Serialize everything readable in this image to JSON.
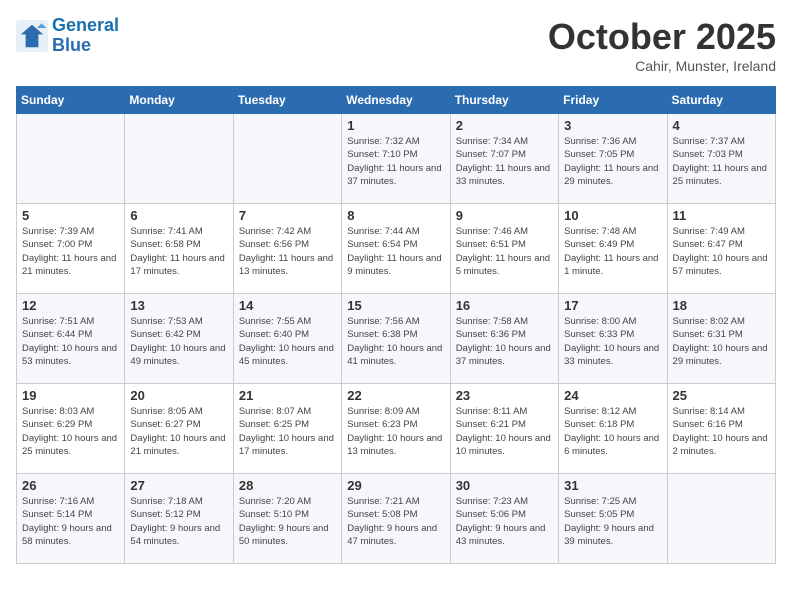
{
  "header": {
    "logo_line1": "General",
    "logo_line2": "Blue",
    "month": "October 2025",
    "location": "Cahir, Munster, Ireland"
  },
  "weekdays": [
    "Sunday",
    "Monday",
    "Tuesday",
    "Wednesday",
    "Thursday",
    "Friday",
    "Saturday"
  ],
  "weeks": [
    [
      {
        "day": "",
        "info": ""
      },
      {
        "day": "",
        "info": ""
      },
      {
        "day": "",
        "info": ""
      },
      {
        "day": "1",
        "info": "Sunrise: 7:32 AM\nSunset: 7:10 PM\nDaylight: 11 hours\nand 37 minutes."
      },
      {
        "day": "2",
        "info": "Sunrise: 7:34 AM\nSunset: 7:07 PM\nDaylight: 11 hours\nand 33 minutes."
      },
      {
        "day": "3",
        "info": "Sunrise: 7:36 AM\nSunset: 7:05 PM\nDaylight: 11 hours\nand 29 minutes."
      },
      {
        "day": "4",
        "info": "Sunrise: 7:37 AM\nSunset: 7:03 PM\nDaylight: 11 hours\nand 25 minutes."
      }
    ],
    [
      {
        "day": "5",
        "info": "Sunrise: 7:39 AM\nSunset: 7:00 PM\nDaylight: 11 hours\nand 21 minutes."
      },
      {
        "day": "6",
        "info": "Sunrise: 7:41 AM\nSunset: 6:58 PM\nDaylight: 11 hours\nand 17 minutes."
      },
      {
        "day": "7",
        "info": "Sunrise: 7:42 AM\nSunset: 6:56 PM\nDaylight: 11 hours\nand 13 minutes."
      },
      {
        "day": "8",
        "info": "Sunrise: 7:44 AM\nSunset: 6:54 PM\nDaylight: 11 hours\nand 9 minutes."
      },
      {
        "day": "9",
        "info": "Sunrise: 7:46 AM\nSunset: 6:51 PM\nDaylight: 11 hours\nand 5 minutes."
      },
      {
        "day": "10",
        "info": "Sunrise: 7:48 AM\nSunset: 6:49 PM\nDaylight: 11 hours\nand 1 minute."
      },
      {
        "day": "11",
        "info": "Sunrise: 7:49 AM\nSunset: 6:47 PM\nDaylight: 10 hours\nand 57 minutes."
      }
    ],
    [
      {
        "day": "12",
        "info": "Sunrise: 7:51 AM\nSunset: 6:44 PM\nDaylight: 10 hours\nand 53 minutes."
      },
      {
        "day": "13",
        "info": "Sunrise: 7:53 AM\nSunset: 6:42 PM\nDaylight: 10 hours\nand 49 minutes."
      },
      {
        "day": "14",
        "info": "Sunrise: 7:55 AM\nSunset: 6:40 PM\nDaylight: 10 hours\nand 45 minutes."
      },
      {
        "day": "15",
        "info": "Sunrise: 7:56 AM\nSunset: 6:38 PM\nDaylight: 10 hours\nand 41 minutes."
      },
      {
        "day": "16",
        "info": "Sunrise: 7:58 AM\nSunset: 6:36 PM\nDaylight: 10 hours\nand 37 minutes."
      },
      {
        "day": "17",
        "info": "Sunrise: 8:00 AM\nSunset: 6:33 PM\nDaylight: 10 hours\nand 33 minutes."
      },
      {
        "day": "18",
        "info": "Sunrise: 8:02 AM\nSunset: 6:31 PM\nDaylight: 10 hours\nand 29 minutes."
      }
    ],
    [
      {
        "day": "19",
        "info": "Sunrise: 8:03 AM\nSunset: 6:29 PM\nDaylight: 10 hours\nand 25 minutes."
      },
      {
        "day": "20",
        "info": "Sunrise: 8:05 AM\nSunset: 6:27 PM\nDaylight: 10 hours\nand 21 minutes."
      },
      {
        "day": "21",
        "info": "Sunrise: 8:07 AM\nSunset: 6:25 PM\nDaylight: 10 hours\nand 17 minutes."
      },
      {
        "day": "22",
        "info": "Sunrise: 8:09 AM\nSunset: 6:23 PM\nDaylight: 10 hours\nand 13 minutes."
      },
      {
        "day": "23",
        "info": "Sunrise: 8:11 AM\nSunset: 6:21 PM\nDaylight: 10 hours\nand 10 minutes."
      },
      {
        "day": "24",
        "info": "Sunrise: 8:12 AM\nSunset: 6:18 PM\nDaylight: 10 hours\nand 6 minutes."
      },
      {
        "day": "25",
        "info": "Sunrise: 8:14 AM\nSunset: 6:16 PM\nDaylight: 10 hours\nand 2 minutes."
      }
    ],
    [
      {
        "day": "26",
        "info": "Sunrise: 7:16 AM\nSunset: 5:14 PM\nDaylight: 9 hours\nand 58 minutes."
      },
      {
        "day": "27",
        "info": "Sunrise: 7:18 AM\nSunset: 5:12 PM\nDaylight: 9 hours\nand 54 minutes."
      },
      {
        "day": "28",
        "info": "Sunrise: 7:20 AM\nSunset: 5:10 PM\nDaylight: 9 hours\nand 50 minutes."
      },
      {
        "day": "29",
        "info": "Sunrise: 7:21 AM\nSunset: 5:08 PM\nDaylight: 9 hours\nand 47 minutes."
      },
      {
        "day": "30",
        "info": "Sunrise: 7:23 AM\nSunset: 5:06 PM\nDaylight: 9 hours\nand 43 minutes."
      },
      {
        "day": "31",
        "info": "Sunrise: 7:25 AM\nSunset: 5:05 PM\nDaylight: 9 hours\nand 39 minutes."
      },
      {
        "day": "",
        "info": ""
      }
    ]
  ]
}
